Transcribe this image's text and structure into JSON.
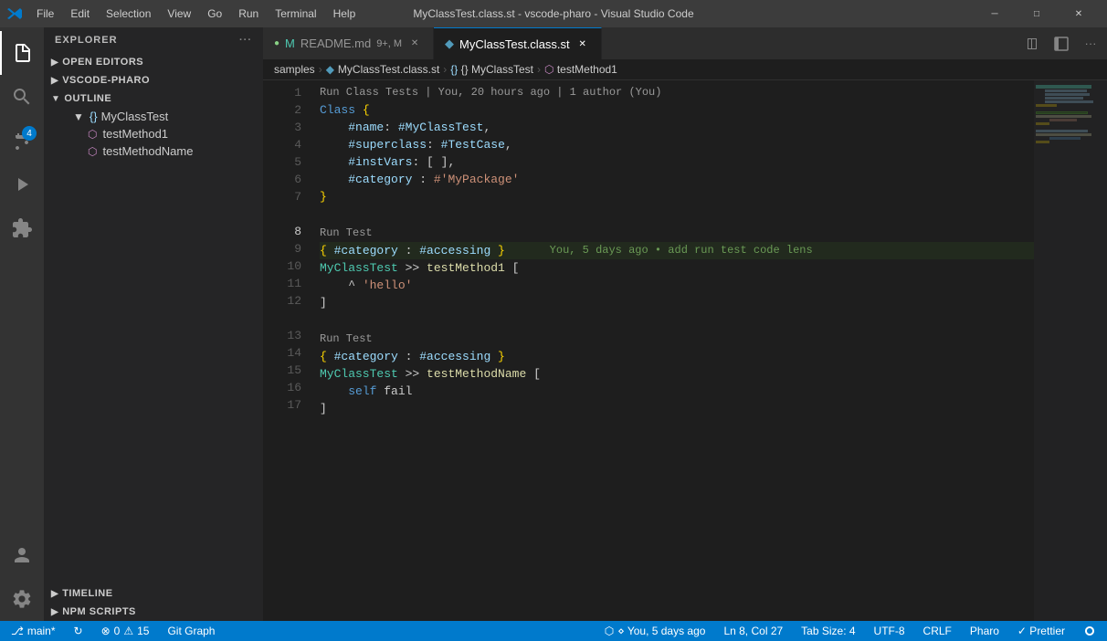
{
  "titlebar": {
    "title": "MyClassTest.class.st - vscode-pharo - Visual Studio Code",
    "menus": [
      "File",
      "Edit",
      "Selection",
      "View",
      "Go",
      "Run",
      "Terminal",
      "Help"
    ]
  },
  "activity": {
    "buttons": [
      "explorer",
      "search",
      "source-control",
      "run-debug",
      "extensions"
    ]
  },
  "sidebar": {
    "title": "Explorer",
    "open_editors": "Open Editors",
    "vscode_pharo": "VSCODE-PHARO",
    "outline": "Outline",
    "outline_class": "MyClassTest",
    "outline_method1": "testMethod1",
    "outline_method2": "testMethodName",
    "timeline": "Timeline",
    "npm_scripts": "NPM Scripts"
  },
  "tabs": {
    "readme": {
      "label": "README.md",
      "badge": "9+, M"
    },
    "classfile": {
      "label": "MyClassTest.class.st"
    }
  },
  "breadcrumb": {
    "parts": [
      "samples",
      "MyClassTest.class.st",
      "{} MyClassTest",
      "testMethod1"
    ]
  },
  "git_info": "Run Class Tests | You, 20 hours ago | 1 author (You)",
  "code": {
    "lines": [
      {
        "num": 1,
        "content": "Class {",
        "type": "normal"
      },
      {
        "num": 2,
        "content": "    #name: #MyClassTest,",
        "type": "normal"
      },
      {
        "num": 3,
        "content": "    #superclass: #TestCase,",
        "type": "normal"
      },
      {
        "num": 4,
        "content": "    #instVars: [ ],",
        "type": "normal"
      },
      {
        "num": 5,
        "content": "    #category : #'MyPackage'",
        "type": "normal"
      },
      {
        "num": 6,
        "content": "}",
        "type": "normal"
      },
      {
        "num": 7,
        "content": "",
        "type": "normal"
      },
      {
        "num": "",
        "content": "Run Test",
        "type": "lens"
      },
      {
        "num": 8,
        "content": "{ #category : #accessing }    You, 5 days ago • add run test code lens",
        "type": "highlighted"
      },
      {
        "num": 9,
        "content": "MyClassTest >> testMethod1 [",
        "type": "normal"
      },
      {
        "num": 10,
        "content": "    ^ 'hello'",
        "type": "normal"
      },
      {
        "num": 11,
        "content": "]",
        "type": "normal"
      },
      {
        "num": 12,
        "content": "",
        "type": "normal"
      },
      {
        "num": "",
        "content": "Run Test",
        "type": "lens"
      },
      {
        "num": 13,
        "content": "{ #category : #accessing }",
        "type": "normal"
      },
      {
        "num": 14,
        "content": "MyClassTest >> testMethodName [",
        "type": "normal"
      },
      {
        "num": 15,
        "content": "    self fail",
        "type": "normal"
      },
      {
        "num": 16,
        "content": "]",
        "type": "normal"
      },
      {
        "num": 17,
        "content": "",
        "type": "normal"
      }
    ]
  },
  "statusbar": {
    "branch": "main*",
    "sync": "↻",
    "errors": "0",
    "warnings": "15",
    "git_graph": "Git Graph",
    "git_info": "⋄ You, 5 days ago",
    "position": "Ln 8, Col 27",
    "tab_size": "Tab Size: 4",
    "encoding": "UTF-8",
    "line_ending": "CRLF",
    "language": "Pharo",
    "formatter": "✓ Prettier"
  }
}
